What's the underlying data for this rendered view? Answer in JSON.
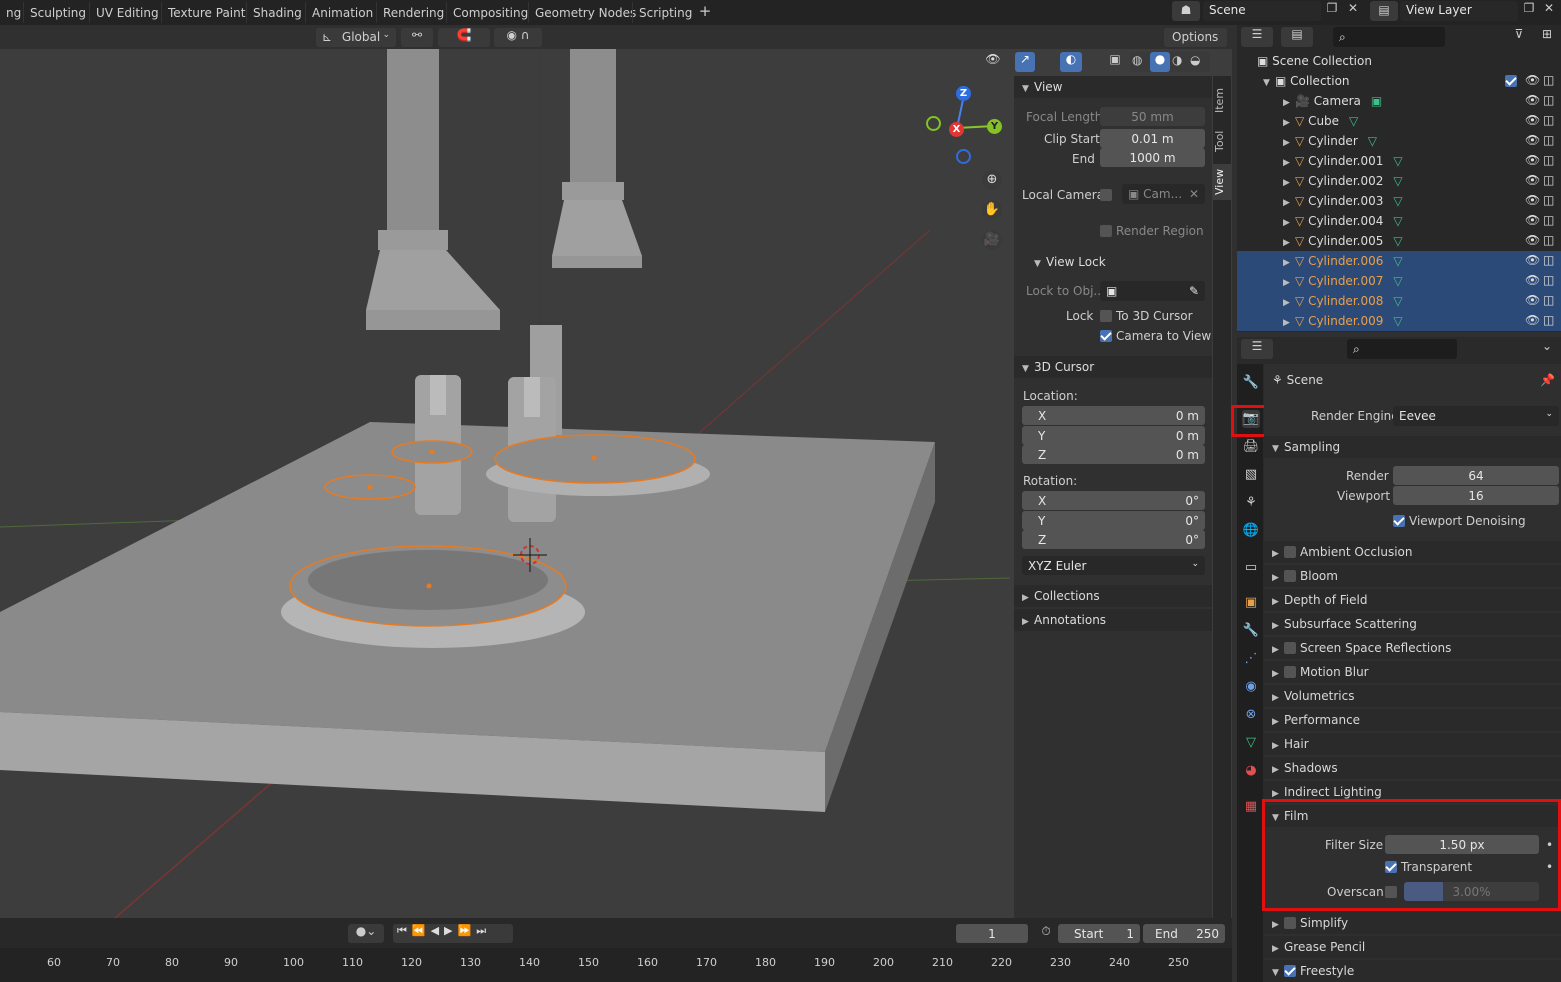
{
  "workspace_tabs": [
    "ng",
    "Sculpting",
    "UV Editing",
    "Texture Paint",
    "Shading",
    "Animation",
    "Rendering",
    "Compositing",
    "Geometry Nodes",
    "Scripting"
  ],
  "scene_name": "Scene",
  "view_layer": "View Layer",
  "header": {
    "orientation": "Global",
    "options": "Options"
  },
  "gizmo": {
    "x": "X",
    "y": "Y",
    "z": "Z"
  },
  "npanel": {
    "tabs": [
      "Item",
      "Tool",
      "View"
    ],
    "view_title": "View",
    "focal_length_label": "Focal Length",
    "focal_length": "50 mm",
    "clip_start_label": "Clip Start",
    "clip_start": "0.01 m",
    "end_label": "End",
    "clip_end": "1000 m",
    "local_camera_label": "Local Camera",
    "local_camera_value": "Cam...",
    "render_region": "Render Region",
    "view_lock_title": "View Lock",
    "lock_to_obj_label": "Lock to Obj...",
    "lock_label": "Lock",
    "to_3d_cursor": "To 3D Cursor",
    "camera_to_view": "Camera to View",
    "cursor_title": "3D Cursor",
    "location_label": "Location:",
    "loc_x_label": "X",
    "loc_x": "0 m",
    "loc_y_label": "Y",
    "loc_y": "0 m",
    "loc_z_label": "Z",
    "loc_z": "0 m",
    "rotation_label": "Rotation:",
    "rot_x_label": "X",
    "rot_x": "0°",
    "rot_y_label": "Y",
    "rot_y": "0°",
    "rot_z_label": "Z",
    "rot_z": "0°",
    "rotation_mode": "XYZ Euler",
    "collections": "Collections",
    "annotations": "Annotations"
  },
  "timeline": {
    "current_frame": "1",
    "start_label": "Start",
    "start": "1",
    "end_label": "End",
    "end": "250",
    "ticks": [
      "60",
      "70",
      "80",
      "90",
      "100",
      "110",
      "120",
      "130",
      "140",
      "150",
      "160",
      "170",
      "180",
      "190",
      "200",
      "210",
      "220",
      "230",
      "240",
      "250"
    ]
  },
  "outliner": {
    "scene_collection": "Scene Collection",
    "collection": "Collection",
    "items": [
      "Camera",
      "Cube",
      "Cylinder",
      "Cylinder.001",
      "Cylinder.002",
      "Cylinder.003",
      "Cylinder.004",
      "Cylinder.005",
      "Cylinder.006",
      "Cylinder.007",
      "Cylinder.008",
      "Cylinder.009"
    ],
    "selected_from": 8
  },
  "properties": {
    "context": "Scene",
    "render_engine_label": "Render Engine",
    "render_engine": "Eevee",
    "sampling": "Sampling",
    "render_label": "Render",
    "render_samples": "64",
    "viewport_label": "Viewport",
    "viewport_samples": "16",
    "viewport_denoising": "Viewport Denoising",
    "panels_a": [
      {
        "label": "Ambient Occlusion",
        "checkbox": true
      },
      {
        "label": "Bloom",
        "checkbox": true
      },
      {
        "label": "Depth of Field",
        "checkbox": false
      },
      {
        "label": "Subsurface Scattering",
        "checkbox": false
      },
      {
        "label": "Screen Space Reflections",
        "checkbox": true
      },
      {
        "label": "Motion Blur",
        "checkbox": true
      },
      {
        "label": "Volumetrics",
        "checkbox": false
      },
      {
        "label": "Performance",
        "checkbox": false
      },
      {
        "label": "Hair",
        "checkbox": false
      },
      {
        "label": "Shadows",
        "checkbox": false
      },
      {
        "label": "Indirect Lighting",
        "checkbox": false
      }
    ],
    "film": "Film",
    "filter_size_label": "Filter Size",
    "filter_size": "1.50 px",
    "transparent": "Transparent",
    "overscan_label": "Overscan",
    "overscan": "3.00%",
    "simplify": "Simplify",
    "grease_pencil": "Grease Pencil",
    "freestyle": "Freestyle"
  },
  "colors": {
    "accent": "#4772b3",
    "highlight": "#e01010",
    "selected_text": "#e8a04a",
    "outline": "#e87a20"
  }
}
